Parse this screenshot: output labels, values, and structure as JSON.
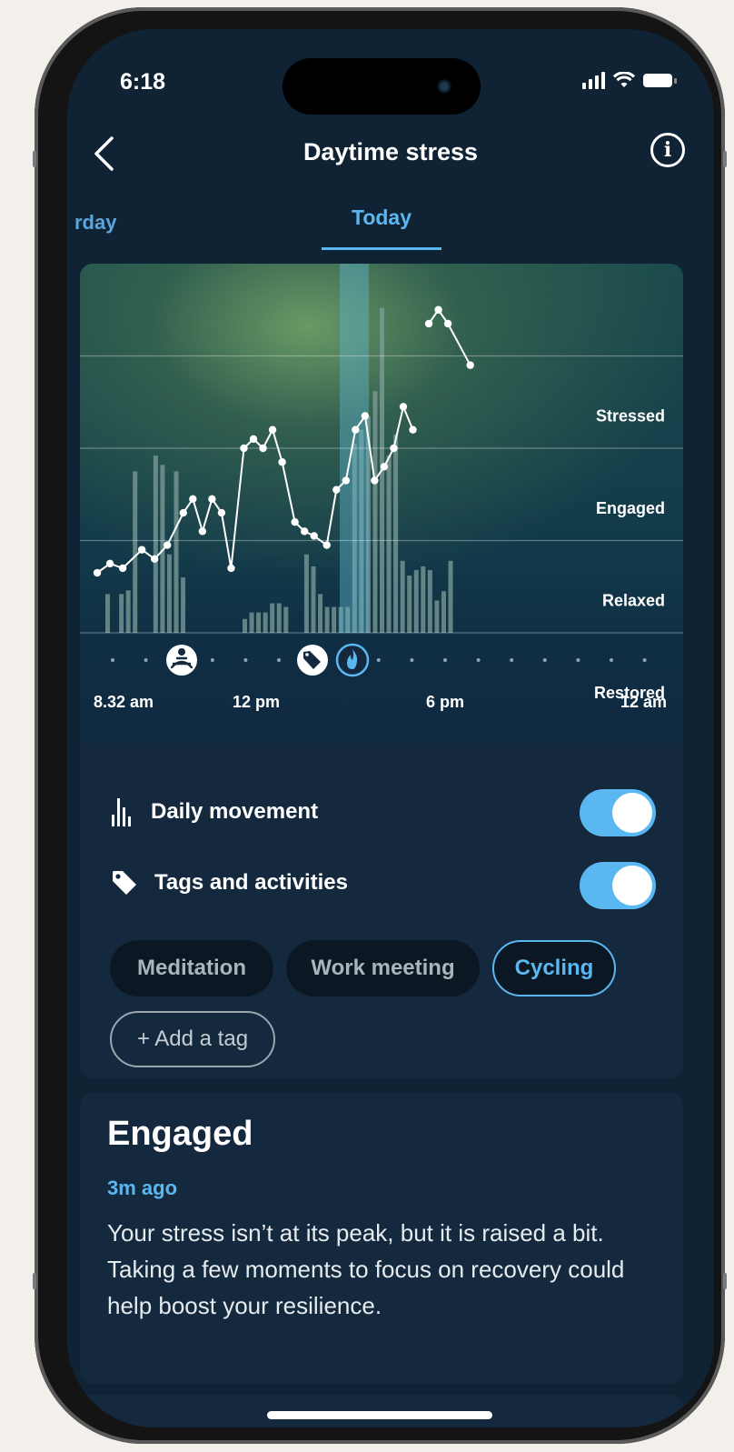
{
  "status_bar": {
    "time": "6:18"
  },
  "header": {
    "title": "Daytime stress"
  },
  "tabs": [
    {
      "label": "rday"
    },
    {
      "label": "Today"
    }
  ],
  "chart_data": {
    "type": "line",
    "levels": [
      "Stressed",
      "Engaged",
      "Relaxed",
      "Restored"
    ],
    "x_tick_labels": [
      "8.32 am",
      "12 pm",
      "6 pm",
      "12 am"
    ],
    "y_scale_note": "0 = bottom, 4 = top",
    "series": [
      {
        "values": [
          [
            0.1,
            0.65
          ],
          [
            0.3,
            0.75
          ],
          [
            0.5,
            0.7
          ],
          [
            0.8,
            0.9
          ],
          [
            1.0,
            0.8
          ],
          [
            1.2,
            0.95
          ],
          [
            1.45,
            1.3
          ],
          [
            1.6,
            1.45
          ],
          [
            1.75,
            1.1
          ],
          [
            1.9,
            1.45
          ],
          [
            2.05,
            1.3
          ],
          [
            2.2,
            0.7
          ],
          [
            2.4,
            2.0
          ],
          [
            2.55,
            2.1
          ],
          [
            2.7,
            2.0
          ],
          [
            2.85,
            2.2
          ],
          [
            3.0,
            1.85
          ],
          [
            3.2,
            1.2
          ],
          [
            3.35,
            1.1
          ],
          [
            3.5,
            1.05
          ],
          [
            3.7,
            0.95
          ],
          [
            3.85,
            1.55
          ],
          [
            4.0,
            1.65
          ],
          [
            4.15,
            2.2
          ],
          [
            4.3,
            2.35
          ],
          [
            4.45,
            1.65
          ],
          [
            4.6,
            1.8
          ],
          [
            4.75,
            2.0
          ],
          [
            4.9,
            2.45
          ],
          [
            5.05,
            2.2
          ]
        ]
      },
      {
        "values": [
          [
            5.3,
            3.35
          ],
          [
            5.45,
            3.5
          ],
          [
            5.6,
            3.35
          ],
          [
            5.95,
            2.9
          ]
        ]
      }
    ],
    "movement_bars": [
      0.42,
      0,
      0.42,
      0.46,
      1.75,
      0,
      0,
      1.92,
      1.82,
      0.85,
      1.75,
      0.6,
      0,
      0,
      0,
      0,
      0,
      0,
      0,
      0,
      0.15,
      0.22,
      0.22,
      0.22,
      0.32,
      0.32,
      0.28,
      0,
      0,
      0.85,
      0.72,
      0.42,
      0.28,
      0.28,
      0.28,
      0.28,
      2.05,
      2.2,
      2.35,
      2.62,
      3.52,
      1.92,
      2.15,
      0.78,
      0.62,
      0.68,
      0.72,
      0.68,
      0.35,
      0.45,
      0.78
    ],
    "highlight_window": [
      4.9,
      5.5
    ],
    "events": [
      "meditation-icon",
      "tag-icon",
      "fire-icon"
    ],
    "accent_color": "#5bb7f0"
  },
  "toggles": [
    {
      "label": "Daily movement",
      "on": true
    },
    {
      "label": "Tags and activities",
      "on": true
    }
  ],
  "tags": [
    {
      "label": "Meditation",
      "selected": false
    },
    {
      "label": "Work meeting",
      "selected": false
    },
    {
      "label": "Cycling",
      "selected": true
    }
  ],
  "add_tag_label": "+ Add a tag",
  "status": {
    "title": "Engaged",
    "time_ago": "3m ago",
    "description": "Your stress isn’t at its peak, but it is raised a bit. Taking a few moments to focus on recovery could help boost your resilience."
  }
}
